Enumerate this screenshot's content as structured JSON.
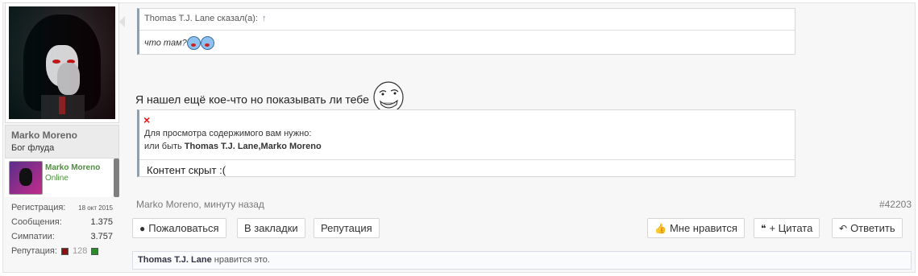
{
  "user": {
    "name": "Marko Moreno",
    "title": "Бог флуда",
    "mini_name": "Marko Moreno",
    "mini_status": "Online",
    "stats": [
      {
        "label": "Регистрация:",
        "value": "18 окт 2015"
      },
      {
        "label": "Сообщения:",
        "value": "1.375"
      },
      {
        "label": "Симпатии:",
        "value": "3.757"
      },
      {
        "label": "Репутация:",
        "value": "128"
      }
    ]
  },
  "quote": {
    "author": "Thomas T.J. Lane сказал(а):",
    "arrow": "↑",
    "text": "что там?"
  },
  "message": {
    "text": "Я нашел ещё кое-что но показывать ли тебе"
  },
  "hidden": {
    "x": "×",
    "line1": "Для просмотра содержимого вам нужно:",
    "line2_prefix": "или быть ",
    "line2_names": "Thomas T.J. Lane,Marko Moreno",
    "content": "Контент скрыт :("
  },
  "meta": {
    "author_time": "Marko Moreno, минуту назад",
    "post_id": "#42203"
  },
  "buttons": {
    "report": "Пожаловаться",
    "bookmarks": "В закладки",
    "reputation": "Репутация",
    "like": "Мне нравится",
    "quote": "+ Цитата",
    "reply": "Ответить"
  },
  "likes": {
    "user": "Thomas T.J. Lane",
    "text": " нравится это."
  },
  "colors": {
    "online": "#4b8f3b",
    "quote_border": "#8e9eab",
    "hidden_x": "#ee1111"
  }
}
